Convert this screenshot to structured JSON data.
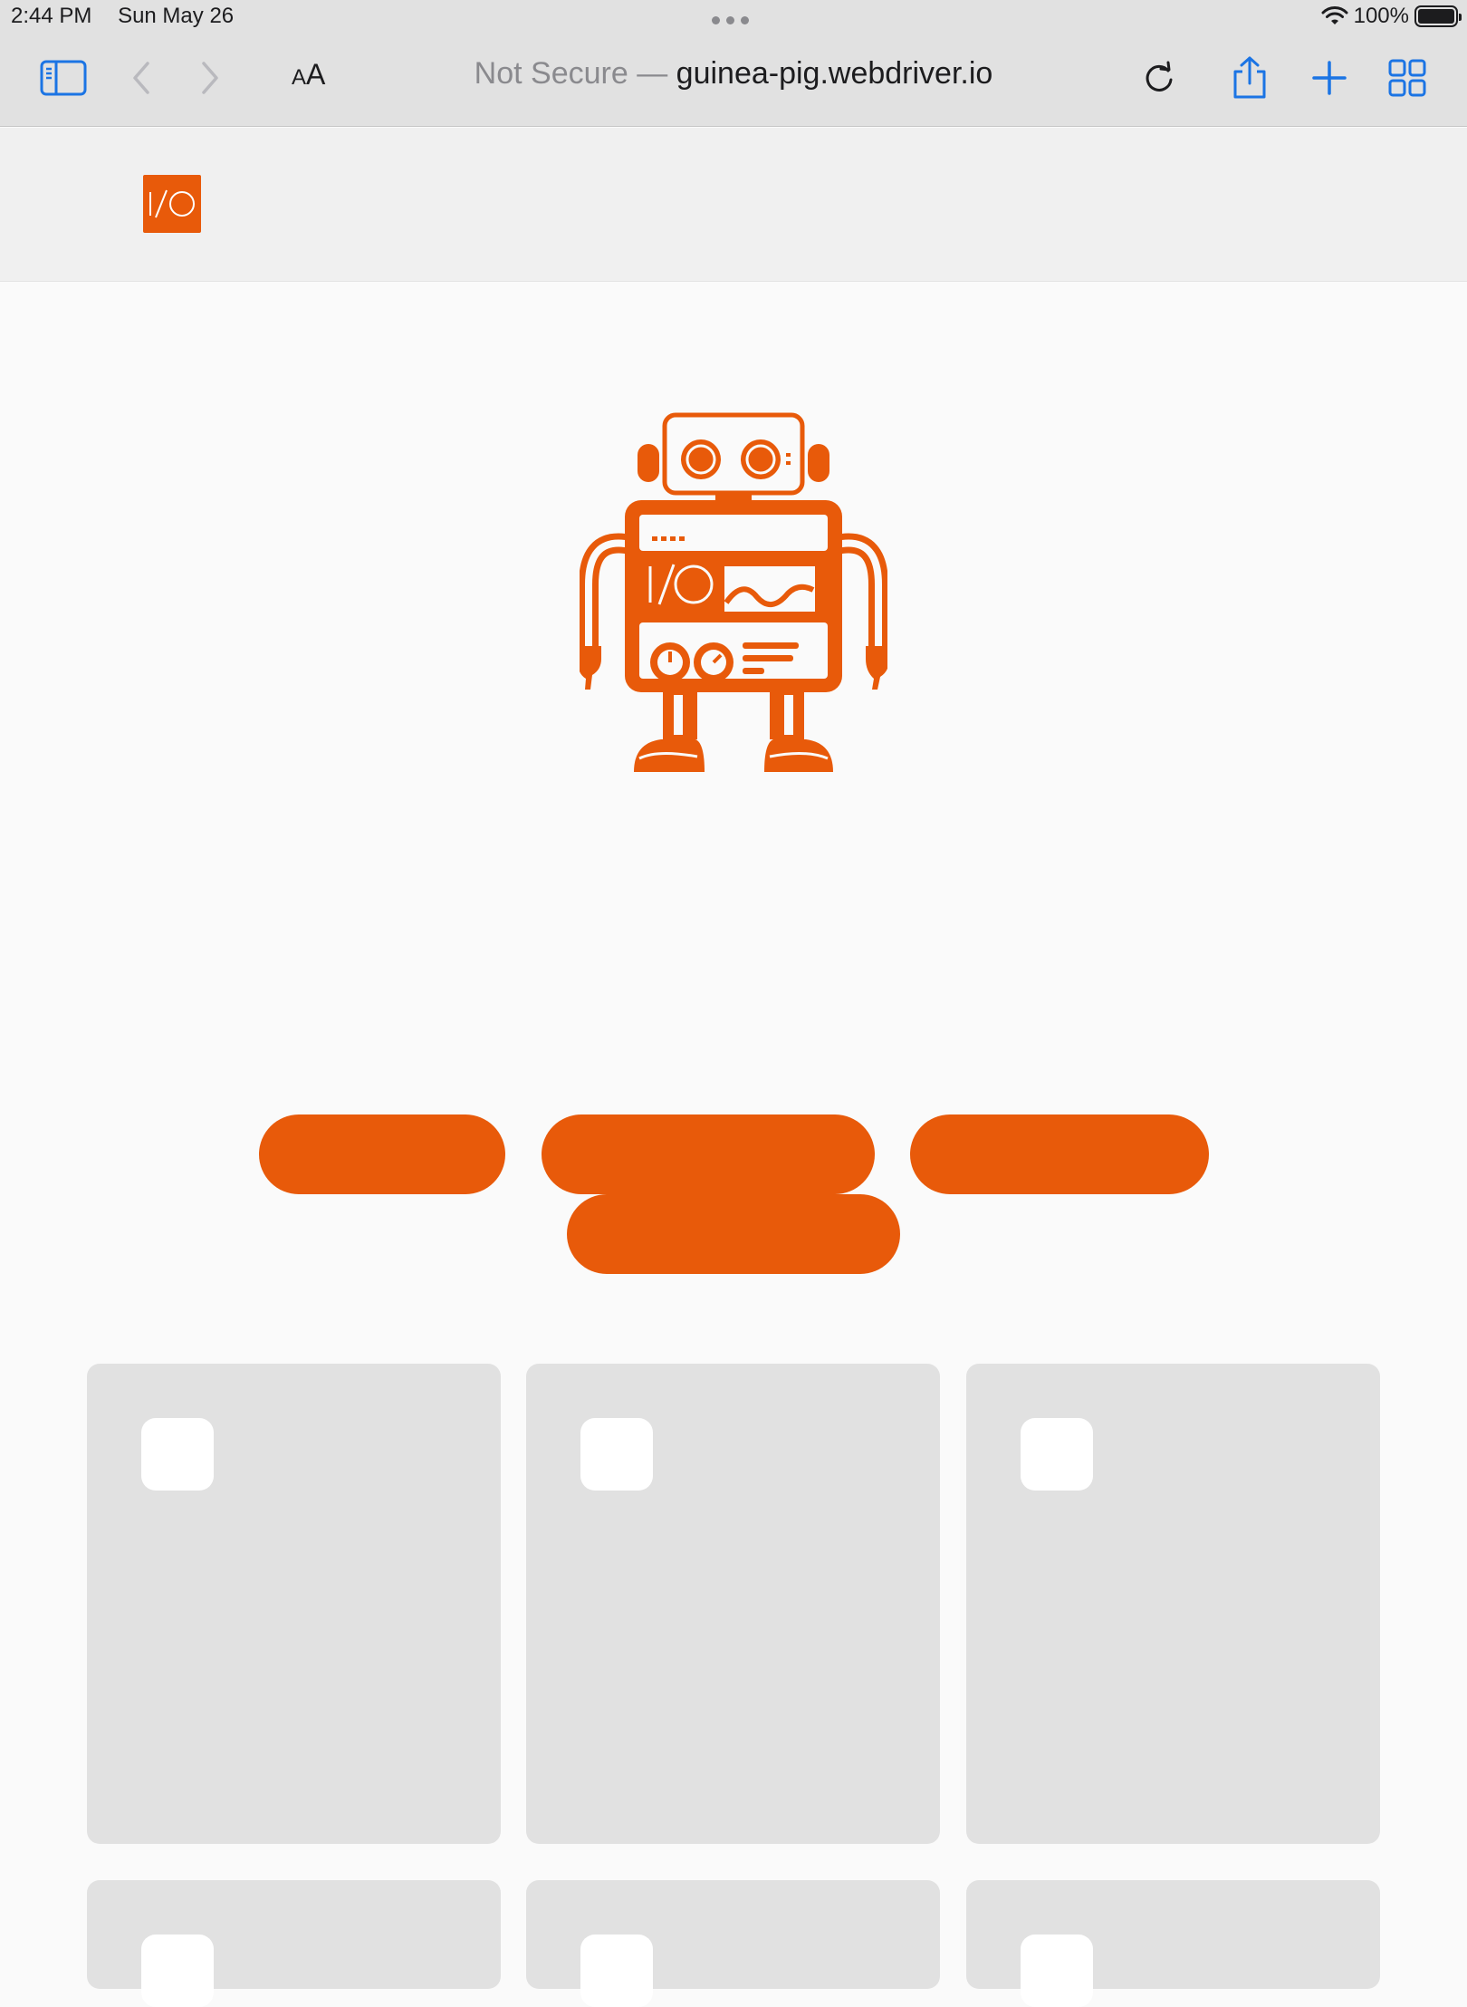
{
  "status_bar": {
    "time": "2:44 PM",
    "date": "Sun May 26",
    "battery": "100%"
  },
  "toolbar": {
    "text_size_label_small": "A",
    "text_size_label_large": "A",
    "security_label": "Not Secure —",
    "domain": "guinea-pig.webdriver.io"
  },
  "site": {
    "logo_text": "I/O",
    "robot_panel_text": "I/O"
  },
  "colors": {
    "brand_orange": "#e85a0a",
    "ios_blue": "#1b74e4",
    "card_gray": "#e1e1e1"
  },
  "icons": [
    "sidebar-icon",
    "back-icon",
    "forward-icon",
    "reload-icon",
    "share-icon",
    "new-tab-icon",
    "tabs-overview-icon",
    "wifi-icon",
    "battery-icon"
  ]
}
